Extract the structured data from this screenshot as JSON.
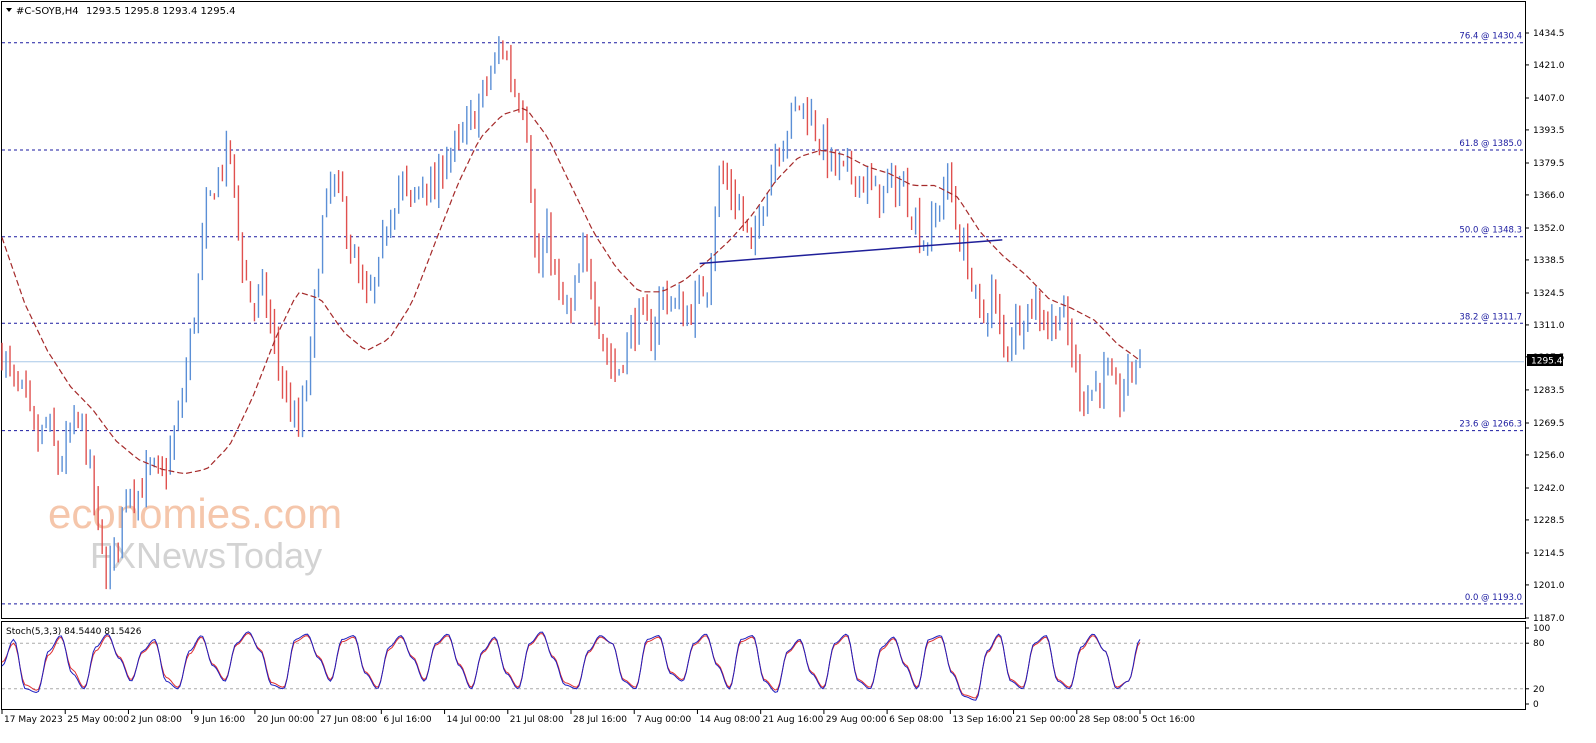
{
  "chart_data": [
    {
      "type": "candlestick",
      "title": "#C-SOYB,H4",
      "ohlc_header": "1293.5 1295.8 1293.4 1295.4",
      "current_price": 1295.4,
      "current_price_label": "1295.4",
      "ylim": [
        1187,
        1441
      ],
      "yticks": [
        "1434.5",
        "1421.0",
        "1407.0",
        "1393.5",
        "1379.5",
        "1366.0",
        "1352.0",
        "1338.5",
        "1324.5",
        "1311.0",
        "1297.5",
        "1283.5",
        "1269.5",
        "1256.0",
        "1242.0",
        "1228.5",
        "1214.5",
        "1201.0",
        "1187.0"
      ],
      "fib_levels": [
        {
          "label": "76.4 @ 1430.4",
          "value": 1430.4
        },
        {
          "label": "61.8 @ 1385.0",
          "value": 1385.0
        },
        {
          "label": "50.0 @ 1348.3",
          "value": 1348.3
        },
        {
          "label": "38.2 @ 1311.7",
          "value": 1311.7
        },
        {
          "label": "23.6 @ 1266.3",
          "value": 1266.3
        },
        {
          "label": "0.0 @ 1193.0",
          "value": 1193.0
        }
      ],
      "close_path": [
        1300,
        1285,
        1280,
        1260,
        1270,
        1250,
        1265,
        1270,
        1240,
        1205,
        1215,
        1245,
        1240,
        1250,
        1245,
        1260,
        1285,
        1320,
        1360,
        1375,
        1385,
        1340,
        1318,
        1325,
        1300,
        1280,
        1265,
        1292,
        1350,
        1372,
        1360,
        1335,
        1320,
        1330,
        1360,
        1372,
        1360,
        1375,
        1365,
        1385,
        1385,
        1395,
        1405,
        1418,
        1430,
        1410,
        1405,
        1330,
        1350,
        1320,
        1315,
        1340,
        1325,
        1300,
        1290,
        1305,
        1315,
        1305,
        1325,
        1320,
        1315,
        1320,
        1330,
        1375,
        1368,
        1358,
        1340,
        1368,
        1385,
        1395,
        1405,
        1400,
        1388,
        1378,
        1375,
        1375,
        1370,
        1365,
        1370,
        1370,
        1360,
        1345,
        1355,
        1375,
        1350,
        1335,
        1310,
        1325,
        1300,
        1312,
        1318,
        1320,
        1310,
        1318,
        1300,
        1280,
        1285,
        1290,
        1278,
        1290,
        1295.4
      ],
      "ma_path": [
        1348,
        1320,
        1300,
        1285,
        1275,
        1262,
        1254,
        1250,
        1248,
        1250,
        1260,
        1280,
        1305,
        1325,
        1322,
        1308,
        1300,
        1305,
        1320,
        1345,
        1370,
        1390,
        1400,
        1403,
        1390,
        1370,
        1350,
        1335,
        1325,
        1325,
        1330,
        1338,
        1347,
        1358,
        1372,
        1382,
        1385,
        1383,
        1378,
        1375,
        1370,
        1370,
        1365,
        1350,
        1340,
        1332,
        1322,
        1318,
        1313,
        1303,
        1296
      ],
      "trendline": {
        "from": {
          "x": 0.613,
          "y": 1337
        },
        "to": {
          "x": 0.879,
          "y": 1347
        }
      },
      "x_labels": [
        "17 May 2023",
        "25 May 00:00",
        "2 Jun 08:00",
        "9 Jun 16:00",
        "20 Jun 00:00",
        "27 Jun 08:00",
        "6 Jul 16:00",
        "14 Jul 00:00",
        "21 Jul 08:00",
        "28 Jul 16:00",
        "7 Aug 00:00",
        "14 Aug 08:00",
        "21 Aug 16:00",
        "29 Aug 00:00",
        "6 Sep 08:00",
        "13 Sep 16:00",
        "21 Sep 00:00",
        "28 Sep 08:00",
        "5 Oct 16:00"
      ],
      "colors": {
        "up": "#5b8fd6",
        "down": "#e0514f",
        "ma": "#a52a2a",
        "fib": "#1a1aa0",
        "trendline": "#1f1f99",
        "price_line": "#a8c8e8"
      }
    },
    {
      "type": "line",
      "title": "Stoch(5,3,3) 84.5440 81.5426",
      "ylim": [
        0,
        100
      ],
      "yticks": [
        "100",
        "80",
        "20",
        "0"
      ],
      "levels": [
        20,
        80
      ],
      "main_path": [
        50,
        85,
        20,
        15,
        70,
        90,
        40,
        20,
        75,
        92,
        60,
        30,
        70,
        85,
        30,
        20,
        70,
        90,
        50,
        30,
        80,
        95,
        70,
        25,
        20,
        85,
        92,
        60,
        30,
        85,
        90,
        40,
        20,
        75,
        90,
        60,
        30,
        80,
        92,
        50,
        20,
        70,
        88,
        40,
        20,
        80,
        95,
        60,
        25,
        20,
        70,
        90,
        80,
        30,
        20,
        85,
        90,
        40,
        30,
        80,
        92,
        50,
        20,
        85,
        90,
        30,
        15,
        70,
        85,
        40,
        20,
        80,
        92,
        30,
        20,
        75,
        88,
        50,
        20,
        85,
        90,
        40,
        10,
        5,
        70,
        92,
        30,
        20,
        80,
        90,
        30,
        20,
        75,
        92,
        70,
        20,
        30,
        85
      ],
      "signal_path": [
        55,
        80,
        25,
        18,
        65,
        88,
        45,
        22,
        70,
        90,
        62,
        32,
        68,
        82,
        35,
        22,
        66,
        88,
        52,
        32,
        78,
        93,
        72,
        28,
        22,
        82,
        90,
        62,
        32,
        82,
        88,
        42,
        22,
        72,
        88,
        62,
        32,
        78,
        90,
        52,
        22,
        68,
        86,
        42,
        22,
        78,
        93,
        62,
        28,
        22,
        68,
        88,
        80,
        32,
        22,
        82,
        88,
        42,
        32,
        78,
        90,
        52,
        22,
        82,
        88,
        32,
        18,
        68,
        83,
        42,
        22,
        78,
        90,
        32,
        22,
        72,
        86,
        52,
        22,
        82,
        88,
        42,
        12,
        8,
        68,
        90,
        32,
        22,
        78,
        88,
        32,
        22,
        72,
        90,
        70,
        22,
        30,
        81
      ],
      "colors": {
        "main": "#1f1fbf",
        "signal": "#e03030",
        "level": "#aaaaaa"
      }
    }
  ],
  "watermark": {
    "line1": "economies.com",
    "line2": "FXNewsToday"
  }
}
